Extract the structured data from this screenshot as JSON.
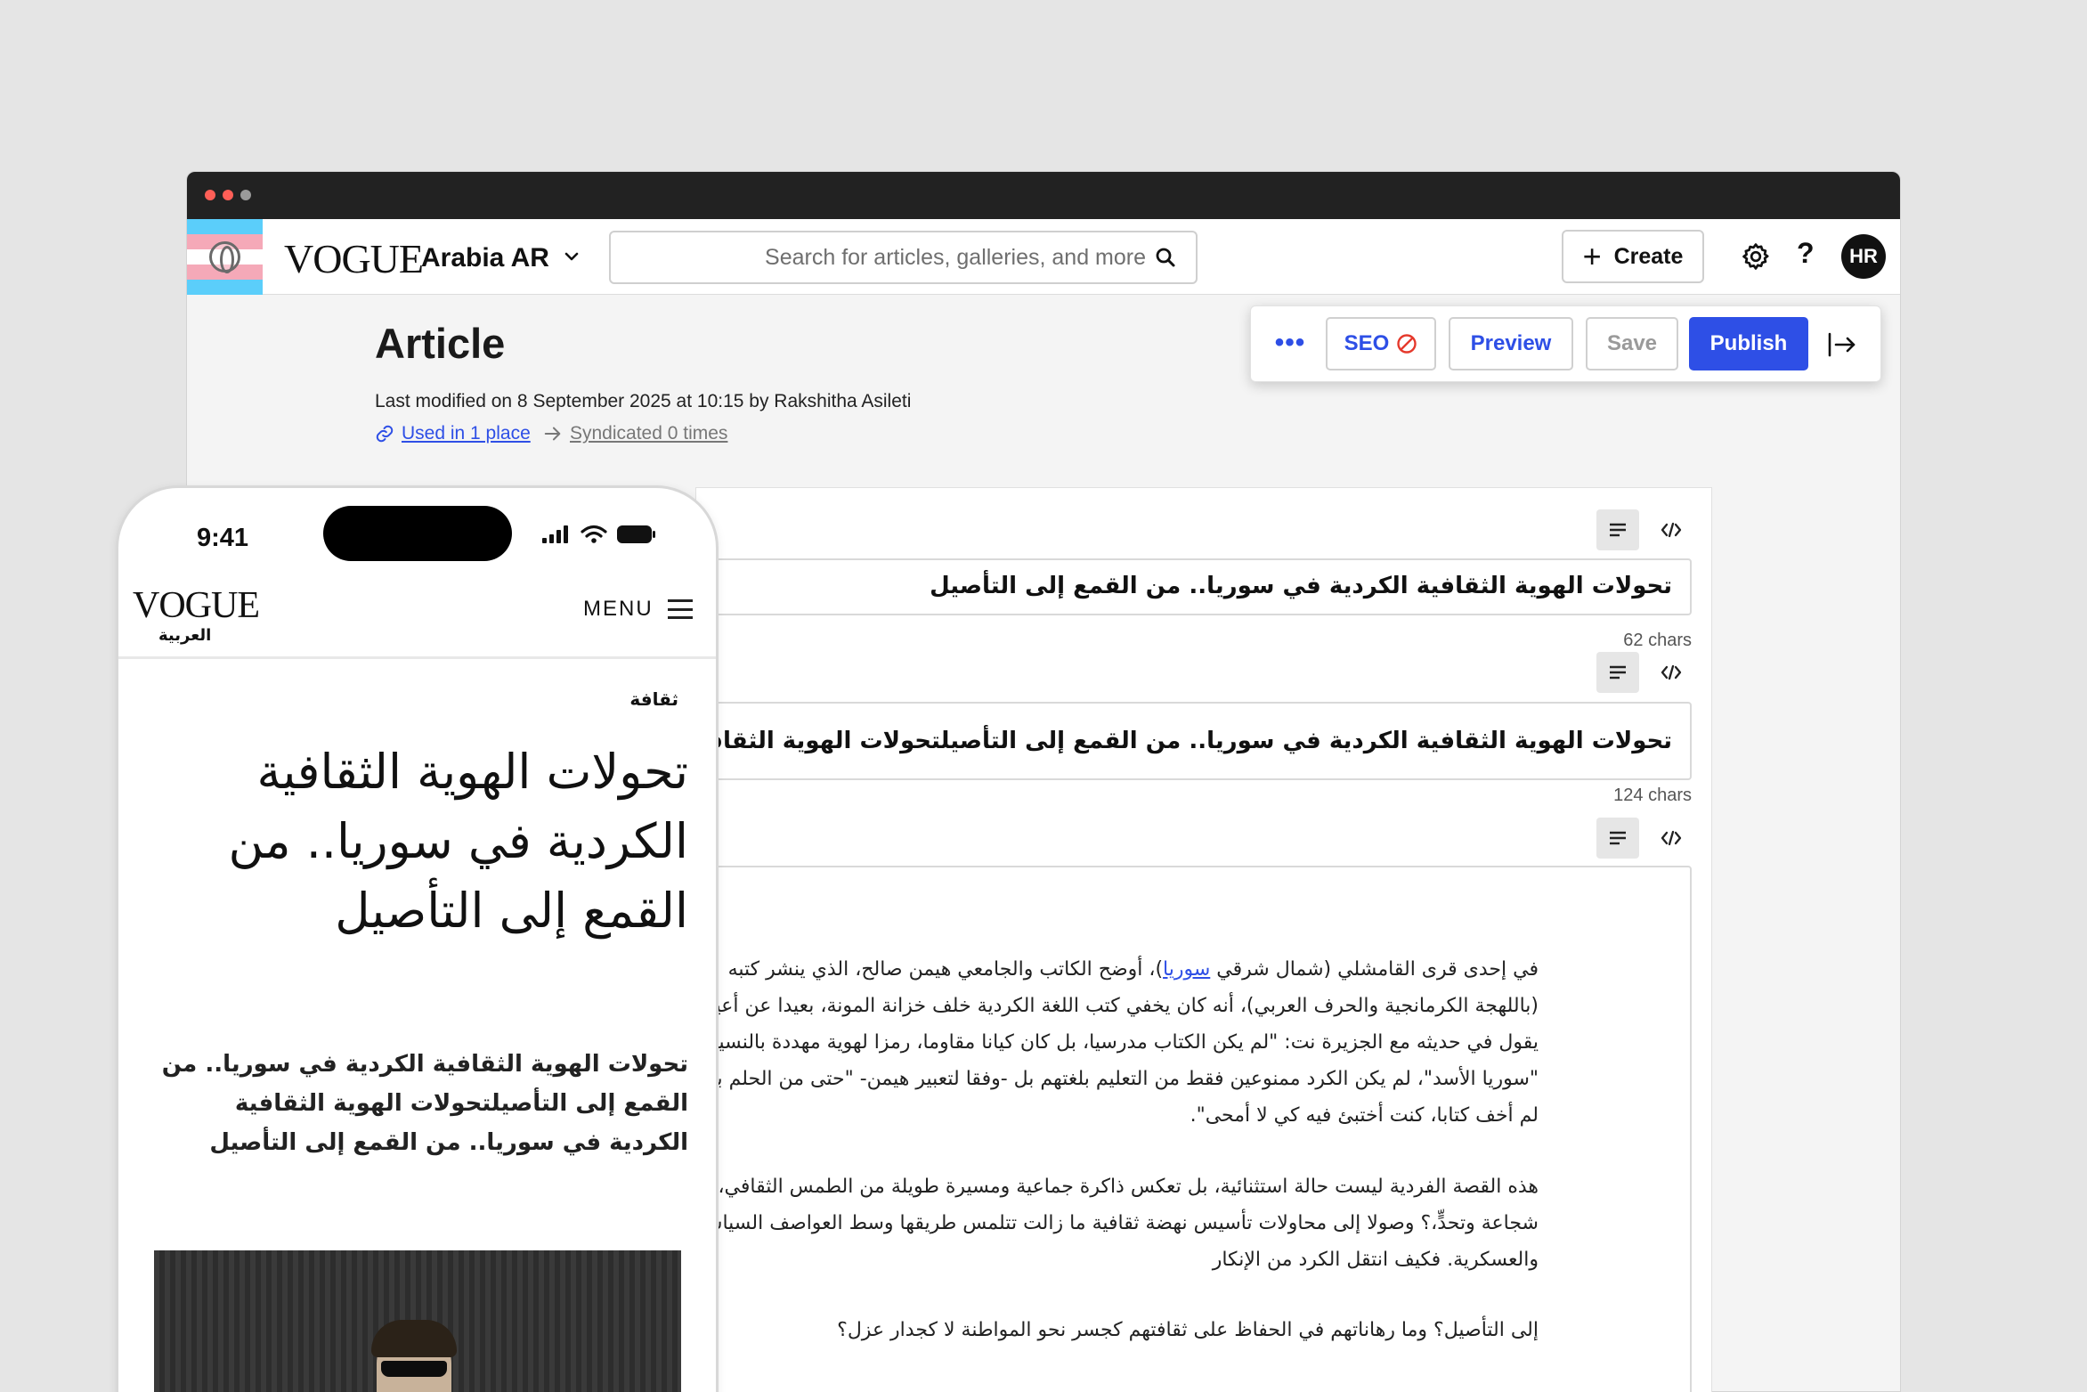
{
  "colors": {
    "accent": "#2e4fe6",
    "background": "#e5e5e5",
    "chrome": "#222222",
    "flag_blue": "#5bcefa",
    "flag_pink": "#f5a9b8",
    "flag_white": "#ffffff",
    "seo_warning": "#e5392c"
  },
  "window": {
    "controls": [
      "close",
      "minimize",
      "maximize"
    ]
  },
  "header": {
    "logo": "VOGUE",
    "site_name": "Arabia AR",
    "search_placeholder": "Search for articles, galleries, and more",
    "create_label": "Create",
    "help_label": "?",
    "avatar_initials": "HR",
    "icons": [
      "chevron-down-icon",
      "search-icon",
      "plus-icon",
      "gear-icon"
    ]
  },
  "article": {
    "page_title": "Article",
    "last_modified": "Last modified on 8 September 2025 at 10:15 by Rakshitha Asileti",
    "used_in": "Used in 1 place",
    "syndicated": "Syndicated 0 times"
  },
  "toolbar": {
    "more_label": "•••",
    "seo_label": "SEO",
    "preview_label": "Preview",
    "save_label": "Save",
    "publish_label": "Publish"
  },
  "editor": {
    "headline_field": {
      "value": "تحولات الهوية الثقافية الكردية في سوريا.. من القمع إلى التأصيل",
      "char_count": "62 chars"
    },
    "subheadline_field": {
      "value": "تحولات الهوية الثقافية الكردية في سوريا.. من القمع إلى التأصيلتحولات الهوية الثقافية الكردية في سوريا.. من القمع إلى التأصيل",
      "char_count": "124 chars"
    },
    "body": {
      "para1_line1_before": "في إحدى قرى القامشلي (شمال شرقي ",
      "para1_link": "سوريا",
      "para1_line1_after": ")، أوضح الكاتب والجامعي هيمن صالح، الذي ينشر كتبه",
      "para1_lines": [
        "(باللهجة الكرمانجية والحرف العربي)، أنه كان يخفي كتب اللغة الكردية خلف خزانة المونة، بعيدا عن أعين",
        "يقول في حديثه مع الجزيرة نت: \"لم يكن الكتاب مدرسيا، بل كان كيانا مقاوما، رمزا لهوية مهددة بالنسيان",
        "\"سوريا الأسد\"، لم يكن الكرد ممنوعين فقط من التعليم بلغتهم بل -وفقا لتعبير هيمن- \"حتى من الحلم بها",
        "لم أخف كتابا، كنت أختبئ فيه كي لا أمحى\"."
      ],
      "para2_lines": [
        "هذه القصة الفردية ليست حالة استثنائية، بل تعكس ذاكرة جماعية ومسيرة طويلة من الطمس الثقافي، تخللتها",
        "شجاعة وتحدٍّ،؟ وصولا إلى محاولات تأسيس نهضة ثقافية ما زالت تتلمس طريقها وسط العواصف السياسية",
        "والعسكرية. فكيف انتقل الكرد من الإنكار"
      ],
      "para3_lines": [
        "إلى التأصيل؟ وما رهاناتهم في الحفاظ على ثقافتهم كجسر نحو المواطنة لا كجدار عزل؟"
      ]
    }
  },
  "phone": {
    "time": "9:41",
    "logo": "VOGUE",
    "logo_sub": "العربية",
    "menu_label": "MENU",
    "category": "ثقافة",
    "headline": "تحولات الهوية الثقافية الكردية في سوريا.. من القمع إلى التأصيل",
    "subheadline": "تحولات الهوية الثقافية الكردية في سوريا.. من القمع إلى التأصيلتحولات الهوية الثقافية الكردية في سوريا.. من القمع إلى التأصيل"
  }
}
